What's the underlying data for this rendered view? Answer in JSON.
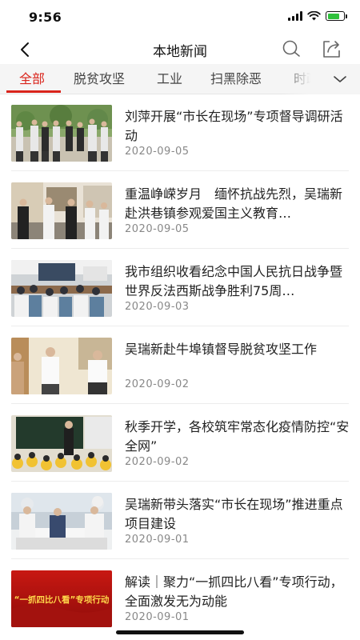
{
  "status_bar": {
    "time": "9:56"
  },
  "nav": {
    "title": "本地新闻"
  },
  "tabs": [
    {
      "label": "全部",
      "active": true
    },
    {
      "label": "脱贫攻坚",
      "active": false
    },
    {
      "label": "工业",
      "active": false
    },
    {
      "label": "扫黑除恶",
      "active": false
    },
    {
      "label": "时政",
      "active": false
    }
  ],
  "news": [
    {
      "title": "刘萍开展“市长在现场”专项督导调研活动",
      "date": "2020-09-05"
    },
    {
      "title": "重温峥嵘岁月　缅怀抗战先烈，吴瑞新赴洪巷镇参观爱国主义教育…",
      "date": "2020-09-05"
    },
    {
      "title": "我市组织收看纪念中国人民抗日战争暨世界反法西斯战争胜利75周…",
      "date": "2020-09-03"
    },
    {
      "title": "吴瑞新赴牛埠镇督导脱贫攻坚工作",
      "date": "2020-09-02"
    },
    {
      "title": "秋季开学，各校筑牢常态化疫情防控“安全网”",
      "date": "2020-09-02"
    },
    {
      "title": "吴瑞新带头落实“市长在现场”推进重点项目建设",
      "date": "2020-09-01"
    },
    {
      "title": "解读｜聚力“一抓四比八看”专项行动，全面激发无为动能",
      "date": "2020-09-01"
    }
  ],
  "thumb_texts": {
    "item7_banner": "“一抓四比八看”专项行动"
  },
  "colors": {
    "accent": "#d9241b",
    "battery": "#2fc13c",
    "tab_bar_bg": "#f5f5f5"
  }
}
